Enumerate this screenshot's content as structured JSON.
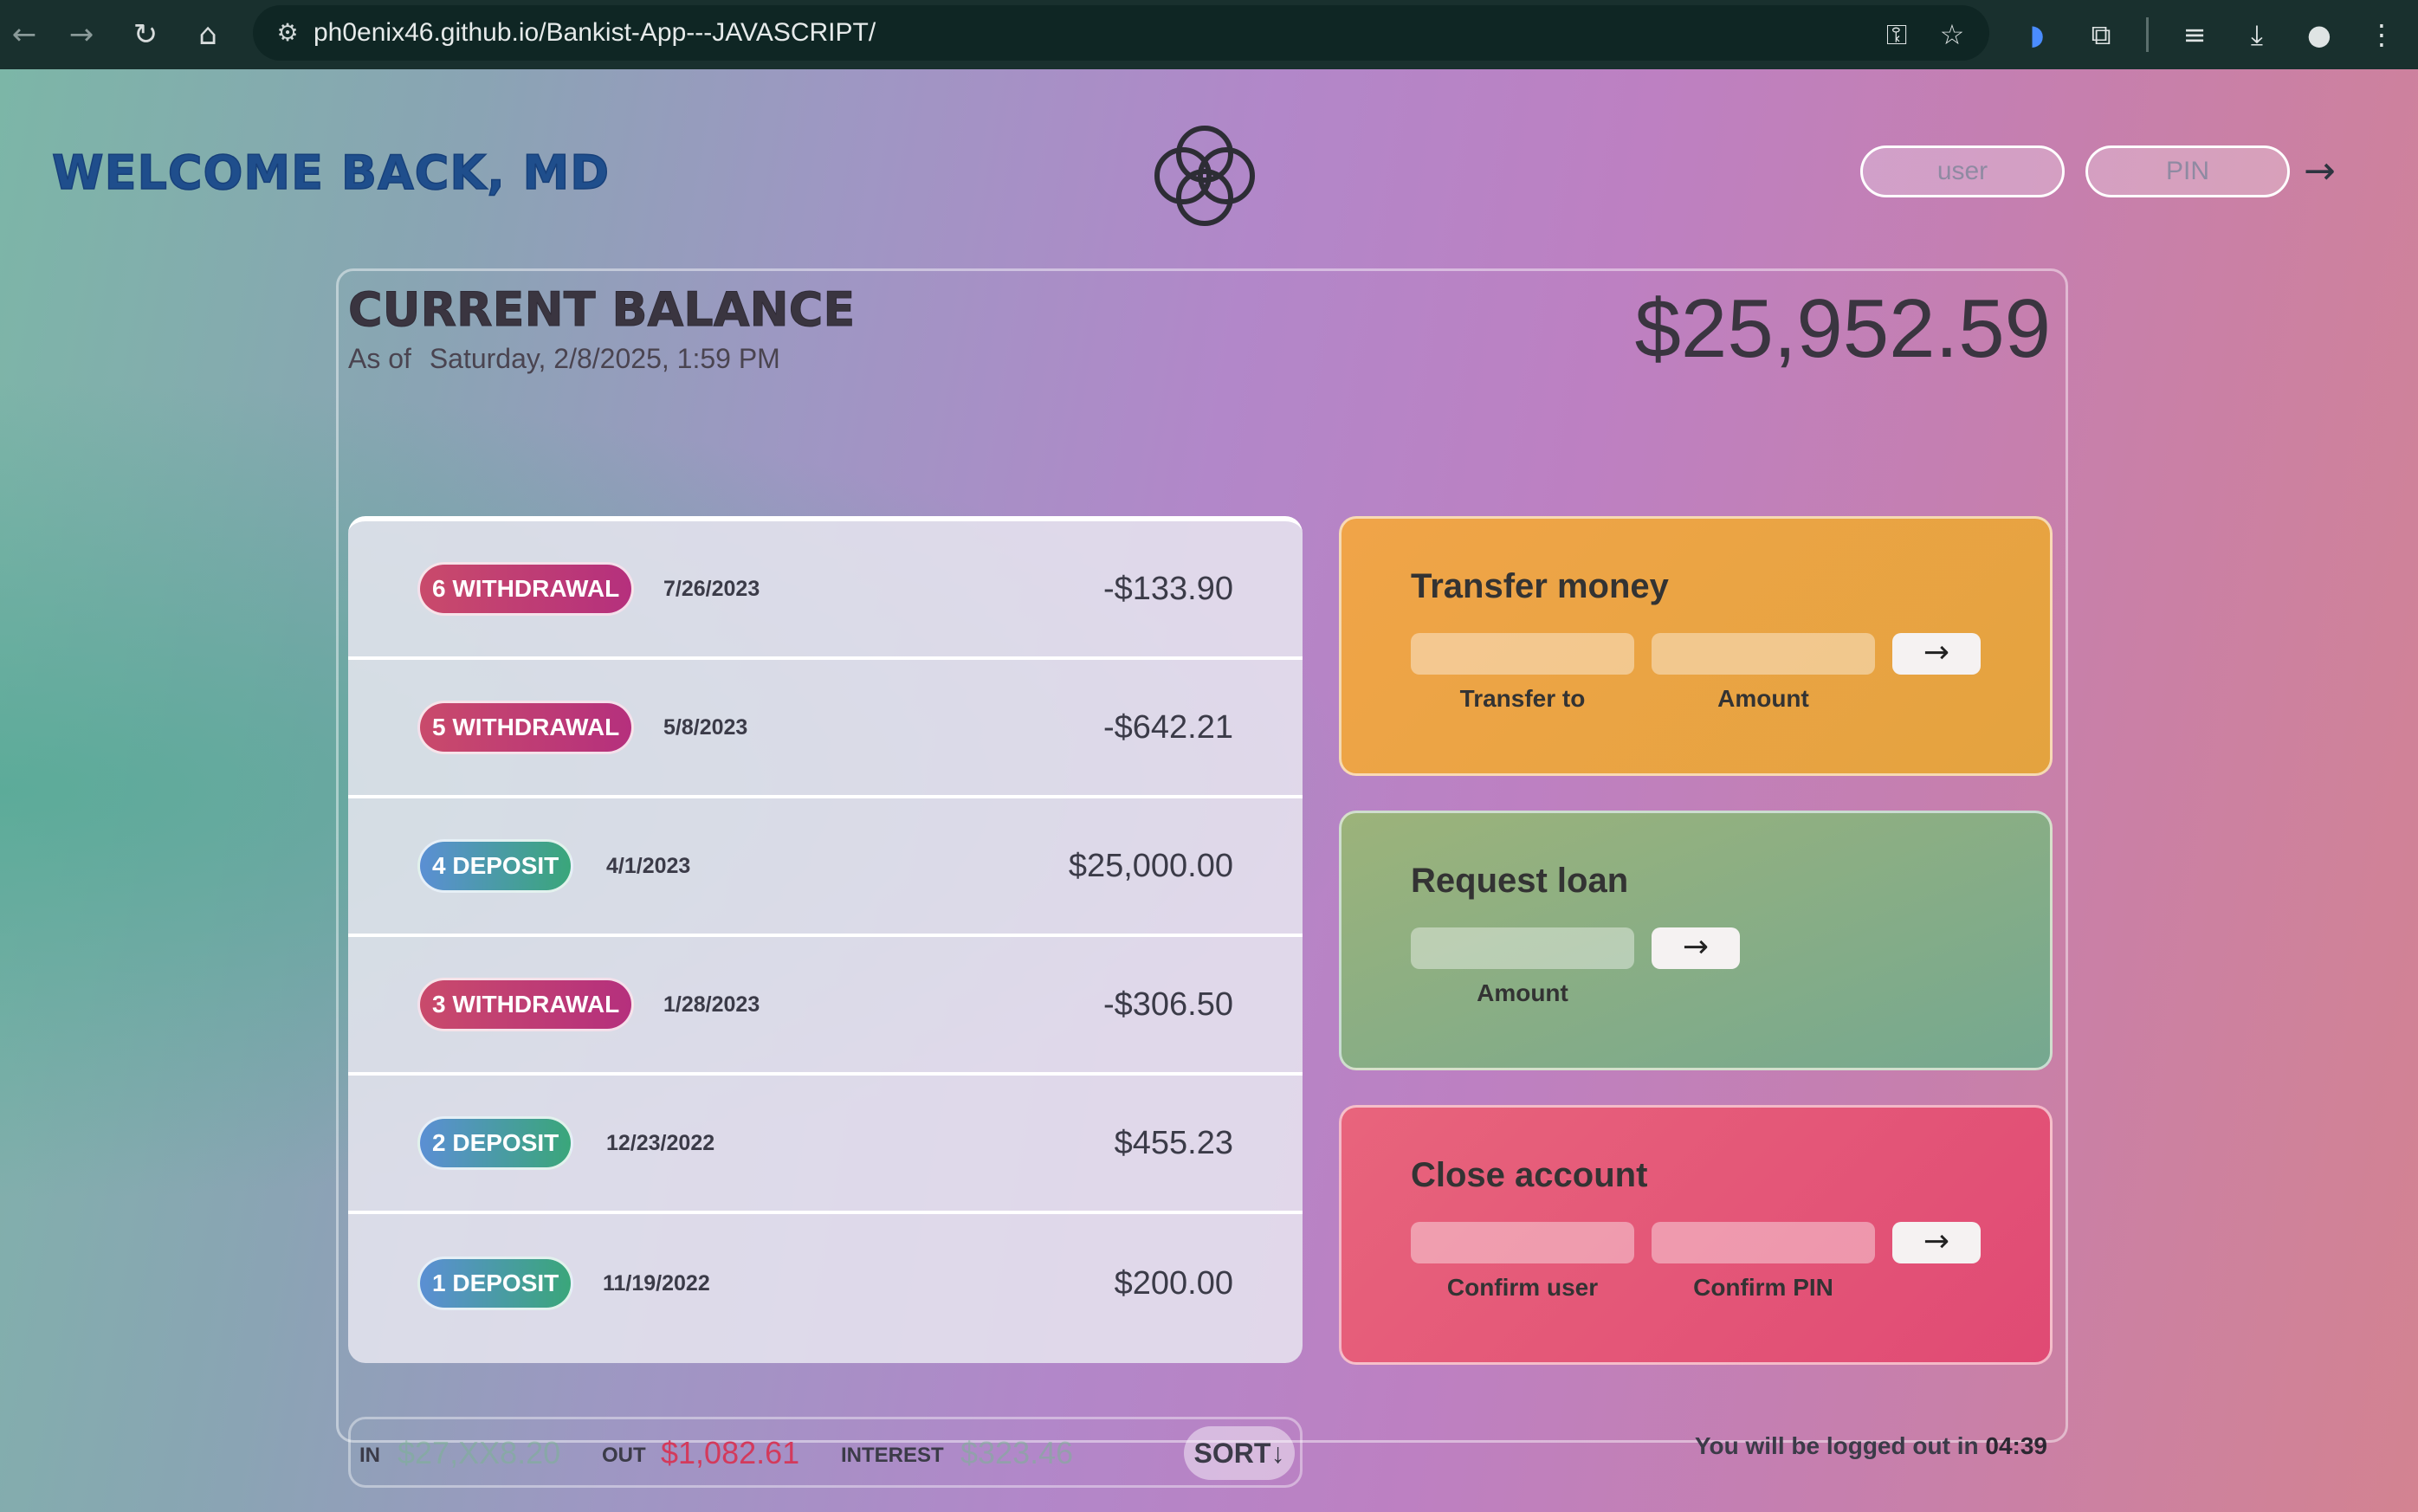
{
  "browser": {
    "url": "ph0enix46.github.io/Bankist-App---JAVASCRIPT/",
    "icons": [
      "back-icon",
      "forward-icon",
      "reload-icon",
      "home-icon",
      "site-info-icon",
      "key-icon",
      "star-icon",
      "media-icon",
      "extensions-icon",
      "reading-list-icon",
      "download-icon",
      "profile-icon",
      "menu-icon"
    ]
  },
  "header": {
    "welcome": "WELCOME BACK, MD",
    "user_placeholder": "user",
    "pin_placeholder": "PIN",
    "login_arrow": "→"
  },
  "balance": {
    "label": "CURRENT BALANCE",
    "as_of_label": "As of",
    "date": "Saturday, 2/8/2025, 1:59 PM",
    "value": "$25,952.59"
  },
  "movements": [
    {
      "type": "6 WITHDRAWAL",
      "kind": "withdrawal",
      "date": "7/26/2023",
      "value": "-$133.90"
    },
    {
      "type": "5 WITHDRAWAL",
      "kind": "withdrawal",
      "date": "5/8/2023",
      "value": "-$642.21"
    },
    {
      "type": "4 DEPOSIT",
      "kind": "deposit",
      "date": "4/1/2023",
      "value": "$25,000.00"
    },
    {
      "type": "3 WITHDRAWAL",
      "kind": "withdrawal",
      "date": "1/28/2023",
      "value": "-$306.50"
    },
    {
      "type": "2 DEPOSIT",
      "kind": "deposit",
      "date": "12/23/2022",
      "value": "$455.23"
    },
    {
      "type": "1 DEPOSIT",
      "kind": "deposit",
      "date": "11/19/2022",
      "value": "$200.00"
    }
  ],
  "operations": {
    "transfer": {
      "title": "Transfer money",
      "to_label": "Transfer to",
      "amount_label": "Amount",
      "button": "→"
    },
    "loan": {
      "title": "Request loan",
      "amount_label": "Amount",
      "button": "→"
    },
    "close": {
      "title": "Close account",
      "user_label": "Confirm user",
      "pin_label": "Confirm PIN",
      "button": "→"
    }
  },
  "summary": {
    "in_label": "IN",
    "in_value": "$27,XX8.20",
    "out_label": "OUT",
    "out_value": "$1,082.61",
    "interest_label": "INTEREST",
    "interest_value": "$323.46",
    "sort_label": "SORT↓"
  },
  "logout": {
    "text": "You will be logged out in",
    "timer": "04:39"
  },
  "colors": {
    "withdrawal": "#c94a6b",
    "deposit": "#3aa67a",
    "transfer": "#f0a448",
    "loan": "#8fb184",
    "close": "#e4566f",
    "out": "#d33a5c",
    "in": "#7bb394"
  }
}
